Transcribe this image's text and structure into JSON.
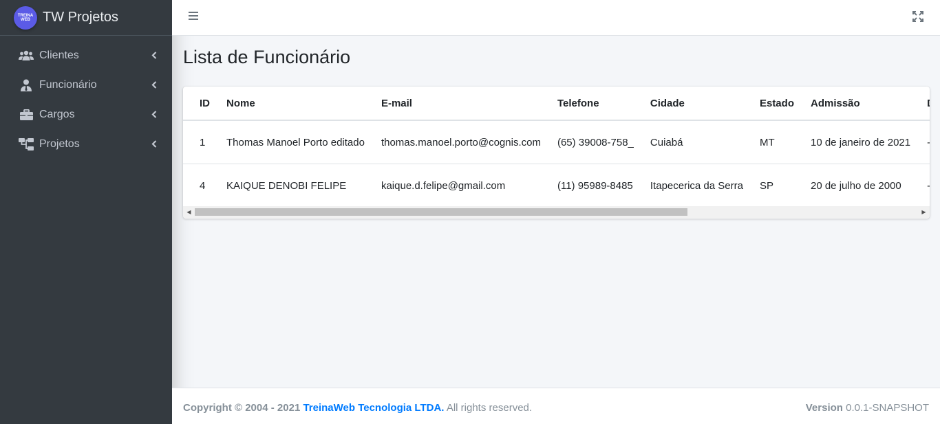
{
  "brand": {
    "logo_text": "TREINA WEB",
    "title": "TW Projetos"
  },
  "sidebar": {
    "items": [
      {
        "label": "Clientes",
        "icon": "users-icon"
      },
      {
        "label": "Funcionário",
        "icon": "user-tie-icon"
      },
      {
        "label": "Cargos",
        "icon": "briefcase-icon"
      },
      {
        "label": "Projetos",
        "icon": "sitemap-icon"
      }
    ]
  },
  "header": {
    "menu_icon": "bars-icon",
    "fullscreen_icon": "expand-icon"
  },
  "main": {
    "title": "Lista de Funcionário",
    "table": {
      "columns": [
        "ID",
        "Nome",
        "E-mail",
        "Telefone",
        "Cidade",
        "Estado",
        "Admissão",
        "De"
      ],
      "rows": [
        [
          "1",
          "Thomas Manoel Porto editado",
          "thomas.manoel.porto@cognis.com",
          "(65) 39008-758_",
          "Cuiabá",
          "MT",
          "10 de janeiro de 2021",
          "-"
        ],
        [
          "4",
          "KAIQUE DENOBI FELIPE",
          "kaique.d.felipe@gmail.com",
          "(11) 95989-8485",
          "Itapecerica da Serra",
          "SP",
          "20 de julho de 2000",
          "-"
        ]
      ]
    }
  },
  "footer": {
    "copyright": "Copyright © 2004 - 2021",
    "company": "TreinaWeb Tecnologia LTDA.",
    "rights": "All rights reserved.",
    "version_label": "Version",
    "version": "0.0.1-SNAPSHOT"
  },
  "colors": {
    "sidebar_bg": "#343a40",
    "link": "#007bff",
    "logo": "#5b5be6"
  }
}
